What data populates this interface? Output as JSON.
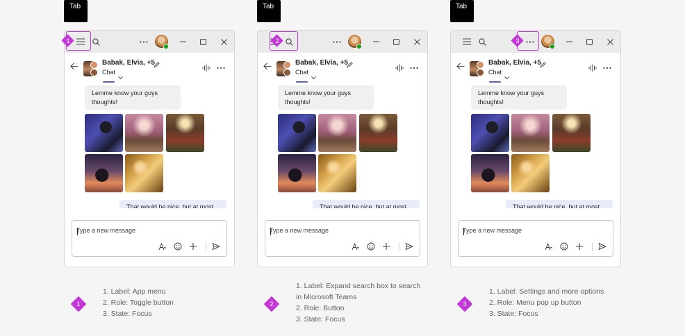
{
  "tab_key": {
    "label": "Tab"
  },
  "chat": {
    "title": "Babak, Elvia, +5",
    "tab_label": "Chat",
    "incoming_message": "Lemme know your guys thoughts!",
    "outgoing_message": "That would be nice, but at most"
  },
  "compose": {
    "placeholder": "Type a new message"
  },
  "examples": [
    {
      "step": "1",
      "focused_control": "app-menu",
      "description": [
        "1. Label: App menu",
        "2. Role: Toggle button",
        "3. State: Focus"
      ]
    },
    {
      "step": "2",
      "focused_control": "search",
      "description": [
        "1. Label: Expand search box to search in Microsoft Teams",
        "2. Role: Button",
        "3. State: Focus"
      ]
    },
    {
      "step": "3",
      "focused_control": "more-options",
      "description": [
        "1. Label: Settings and more options",
        "2. Role: Menu pop up button",
        "3. State: Focus"
      ]
    }
  ],
  "colors": {
    "focus_indicator": "#c239d8",
    "accent": "#5b5fc7",
    "presence_available": "#13a10e",
    "outgoing_bubble": "#e8ebfa",
    "incoming_bubble": "#f0f0f0"
  },
  "icons": [
    "hamburger-icon",
    "search-icon",
    "more-icon",
    "minimize-icon",
    "maximize-icon",
    "close-icon",
    "back-arrow-icon",
    "edit-icon",
    "chevron-down-icon",
    "audio-waveform-icon",
    "format-icon",
    "emoji-icon",
    "add-icon",
    "send-icon"
  ]
}
